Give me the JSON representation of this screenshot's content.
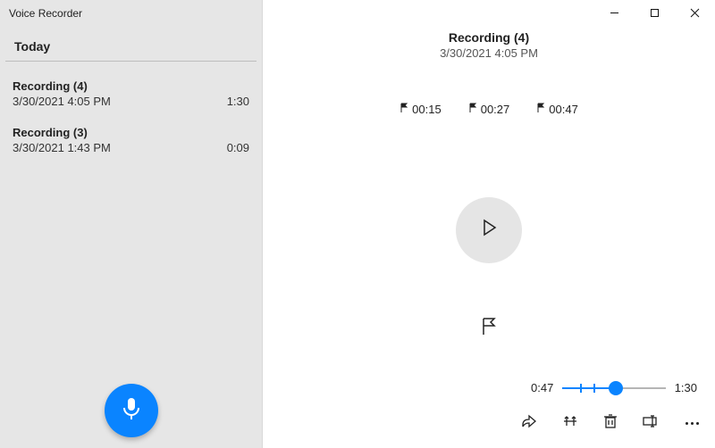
{
  "app_title": "Voice Recorder",
  "section_header": "Today",
  "sidebar": {
    "items": [
      {
        "title": "Recording (4)",
        "date": "3/30/2021 4:05 PM",
        "duration": "1:30",
        "selected": true
      },
      {
        "title": "Recording (3)",
        "date": "3/30/2021 1:43 PM",
        "duration": "0:09",
        "selected": false
      }
    ]
  },
  "recording": {
    "title": "Recording (4)",
    "date": "3/30/2021 4:05 PM",
    "markers": [
      {
        "time": "00:15"
      },
      {
        "time": "00:27"
      },
      {
        "time": "00:47"
      }
    ]
  },
  "timeline": {
    "current": "0:47",
    "total": "1:30",
    "progress_percent": 52,
    "tick_percents": [
      16.7,
      30,
      52
    ]
  },
  "icons": {
    "minimize": "minimize-icon",
    "maximize": "maximize-icon",
    "close": "close-icon",
    "mic": "mic-icon",
    "play": "play-icon",
    "flag": "flag-icon",
    "share": "share-icon",
    "trim": "trim-icon",
    "delete": "trash-icon",
    "rename": "rename-icon",
    "more": "more-icon"
  }
}
